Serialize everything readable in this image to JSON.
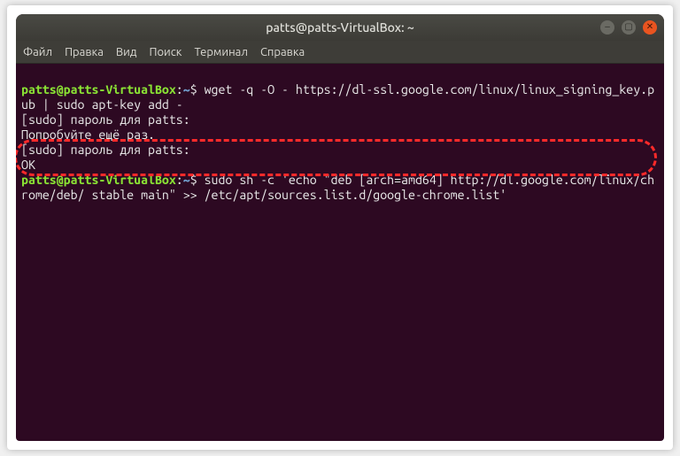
{
  "titlebar": {
    "title": "patts@patts-VirtualBox: ~"
  },
  "window_controls": {
    "minimize_glyph": "–",
    "maximize_glyph": "▢",
    "close_glyph": "✕"
  },
  "menubar": {
    "items": [
      {
        "label": "Файл"
      },
      {
        "label": "Правка"
      },
      {
        "label": "Вид"
      },
      {
        "label": "Поиск"
      },
      {
        "label": "Терминал"
      },
      {
        "label": "Справка"
      }
    ]
  },
  "terminal": {
    "lines": [
      {
        "prompt_user": "patts@patts-VirtualBox",
        "prompt_sep1": ":",
        "prompt_path": "~",
        "prompt_sep2": "$ ",
        "command": "wget -q -O - https://dl-ssl.google.com/linux/linux_signing_key.pub | sudo apt-key add -"
      },
      {
        "text": "[sudo] пароль для patts:"
      },
      {
        "text": "Попробуйте ещё раз."
      },
      {
        "text": "[sudo] пароль для patts:"
      },
      {
        "text": "OK"
      },
      {
        "prompt_user": "patts@patts-VirtualBox",
        "prompt_sep1": ":",
        "prompt_path": "~",
        "prompt_sep2": "$ ",
        "command": "sudo sh -c 'echo \"deb [arch=amd64] http://dl.google.com/linux/chrome/deb/ stable main\" >> /etc/apt/sources.list.d/google-chrome.list'"
      }
    ]
  },
  "highlight": {
    "visible": true
  }
}
